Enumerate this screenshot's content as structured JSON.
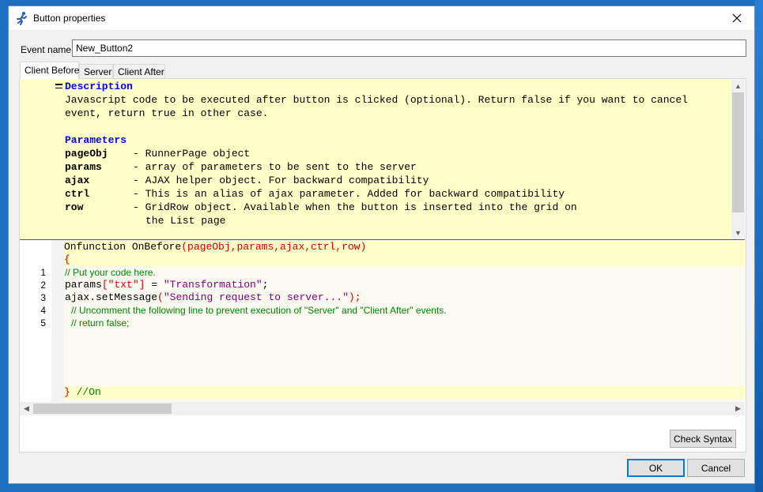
{
  "window": {
    "title": "Button properties"
  },
  "event_name": {
    "label": "Event name:",
    "value": "New_Button2"
  },
  "tabs": [
    {
      "label": "Client Before",
      "active": true
    },
    {
      "label": "Server",
      "active": false
    },
    {
      "label": "Client After",
      "active": false
    }
  ],
  "description": {
    "heading": "Description",
    "text_line1": "Javascript code to be executed after button is clicked (optional). Return false if you want to cancel",
    "text_line2": "event, return true in other case.",
    "params_heading": "Parameters",
    "params": [
      {
        "name": "pageObj",
        "desc": "- RunnerPage object"
      },
      {
        "name": "params",
        "desc": "- array of parameters to be sent to the server"
      },
      {
        "name": "ajax",
        "desc": "- AJAX helper object. For backward compatibility"
      },
      {
        "name": "ctrl",
        "desc": "- This is an alias of ajax parameter. Added for backward compatibility"
      },
      {
        "name": "row",
        "desc": "- GridRow object. Available when the button is inserted into the grid on"
      }
    ],
    "row_cont": "the List page"
  },
  "code": {
    "header_func": "Onfunction OnBefore",
    "header_args": "(pageObj,params,ajax,ctrl,row)",
    "open_brace": "{",
    "close_brace": "}",
    "footer_comment": " //On",
    "lines": [
      {
        "num": "1",
        "text": "// Put your code here."
      },
      {
        "num": "2",
        "pre": "params",
        "bracket": "[\"txt\"]",
        "mid": " = ",
        "str": "\"Transformation\"",
        "post": ";"
      },
      {
        "num": "3",
        "pre": "ajax.setMessage",
        "paren": "(",
        "str": "\"Sending request to server...\"",
        "post": ");"
      },
      {
        "num": "4",
        "text": "// Uncomment the following line to prevent execution of \"Server\" and \"Client After\" events."
      },
      {
        "num": "5",
        "text": "// return false;"
      }
    ]
  },
  "buttons": {
    "check_syntax": "Check Syntax",
    "ok": "OK",
    "cancel": "Cancel"
  }
}
